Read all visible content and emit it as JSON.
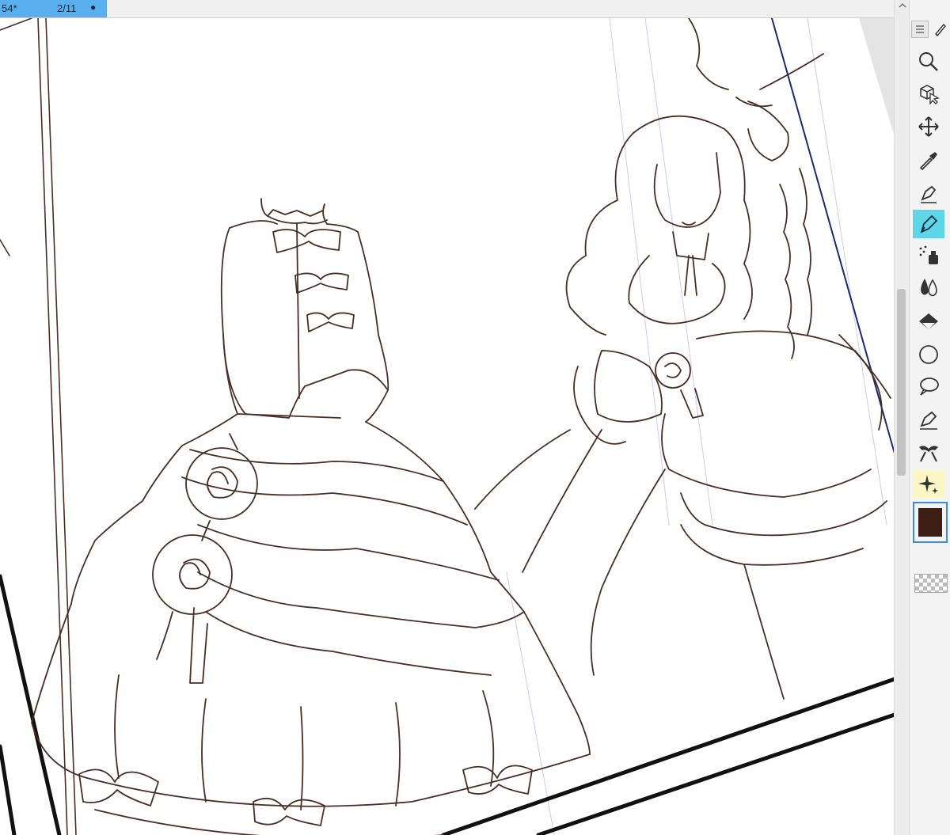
{
  "document_tab": {
    "name": "54*",
    "page": "2/11",
    "dot": "●"
  },
  "colors": {
    "line_art": "#4a2e24",
    "current_color": "#3c1f12",
    "tab_active": "#5ab0ee",
    "tool_active": "#5fd6e8",
    "panel_border": "#111111",
    "guide": "#c8cdf5"
  },
  "toolbar": {
    "tools": [
      {
        "name": "zoom-tool",
        "icon": "magnifier-icon",
        "active": false
      },
      {
        "name": "operation-tool",
        "icon": "cube-cursor-icon",
        "active": false
      },
      {
        "name": "move-layer-tool",
        "icon": "move-arrows-icon",
        "active": false
      },
      {
        "name": "eyedropper-tool",
        "icon": "eyedropper-icon",
        "active": false
      },
      {
        "name": "pen-tool",
        "icon": "pen-nib-icon",
        "active": false
      },
      {
        "name": "pencil-tool",
        "icon": "pencil-nib-icon",
        "active": true
      },
      {
        "name": "airbrush-tool",
        "icon": "airbrush-icon",
        "active": false
      },
      {
        "name": "blend-tool",
        "icon": "blend-drops-icon",
        "active": false
      },
      {
        "name": "fill-tool",
        "icon": "paint-bucket-icon",
        "active": false
      },
      {
        "name": "figure-tool",
        "icon": "circle-icon",
        "active": false
      },
      {
        "name": "text-tool",
        "icon": "speech-balloon-icon",
        "active": false
      },
      {
        "name": "vector-pen-tool",
        "icon": "vector-nib-icon",
        "active": false
      },
      {
        "name": "ruler-tool",
        "icon": "ribbon-icon",
        "active": false
      },
      {
        "name": "decoration-tool",
        "icon": "sparkle-icon",
        "active": false
      }
    ]
  }
}
